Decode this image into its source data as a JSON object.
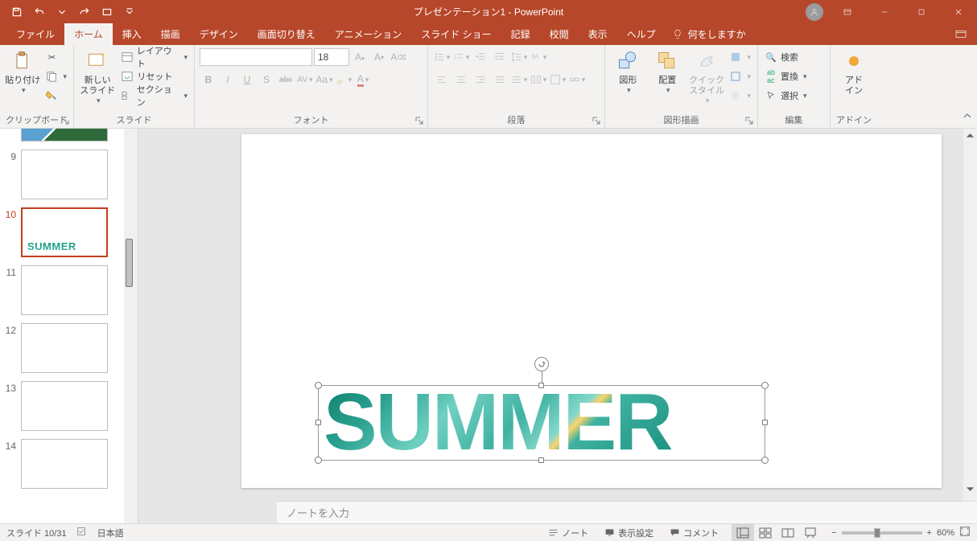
{
  "title": "プレゼンテーション1 - PowerPoint",
  "tabs": {
    "file": "ファイル",
    "home": "ホーム",
    "insert": "挿入",
    "draw": "描画",
    "design": "デザイン",
    "transitions": "画面切り替え",
    "animations": "アニメーション",
    "slideshow": "スライド ショー",
    "record": "記録",
    "review": "校閲",
    "view": "表示",
    "help": "ヘルプ"
  },
  "tellme": "何をしますか",
  "ribbon": {
    "clipboard": {
      "paste": "貼り付け",
      "label": "クリップボード"
    },
    "slides": {
      "newslide": "新しい\nスライド",
      "layout": "レイアウト",
      "reset": "リセット",
      "section": "セクション",
      "label": "スライド"
    },
    "font": {
      "size": "18",
      "label": "フォント",
      "bold": "B",
      "italic": "I",
      "underline": "U",
      "shadow": "S",
      "strike": "abc",
      "spacing": "AV",
      "case": "Aa",
      "clear": "A",
      "color": "A"
    },
    "paragraph": {
      "label": "段落"
    },
    "drawing": {
      "shapes": "図形",
      "arrange": "配置",
      "quick": "クイック\nスタイル",
      "label": "図形描画"
    },
    "editing": {
      "find": "検索",
      "replace": "置換",
      "select": "選択",
      "label": "編集"
    },
    "addins": {
      "addins": "アド\nイン",
      "label": "アドイン"
    }
  },
  "thumbs": [
    {
      "n": "9"
    },
    {
      "n": "10",
      "sel": true,
      "summer": true
    },
    {
      "n": "11"
    },
    {
      "n": "12"
    },
    {
      "n": "13"
    },
    {
      "n": "14"
    }
  ],
  "slide_text": "SUMMER",
  "notes_placeholder": "ノートを入力",
  "status": {
    "slide": "スライド 10/31",
    "lang": "日本語",
    "notes": "ノート",
    "display": "表示設定",
    "comments": "コメント",
    "zoom": "60%"
  }
}
